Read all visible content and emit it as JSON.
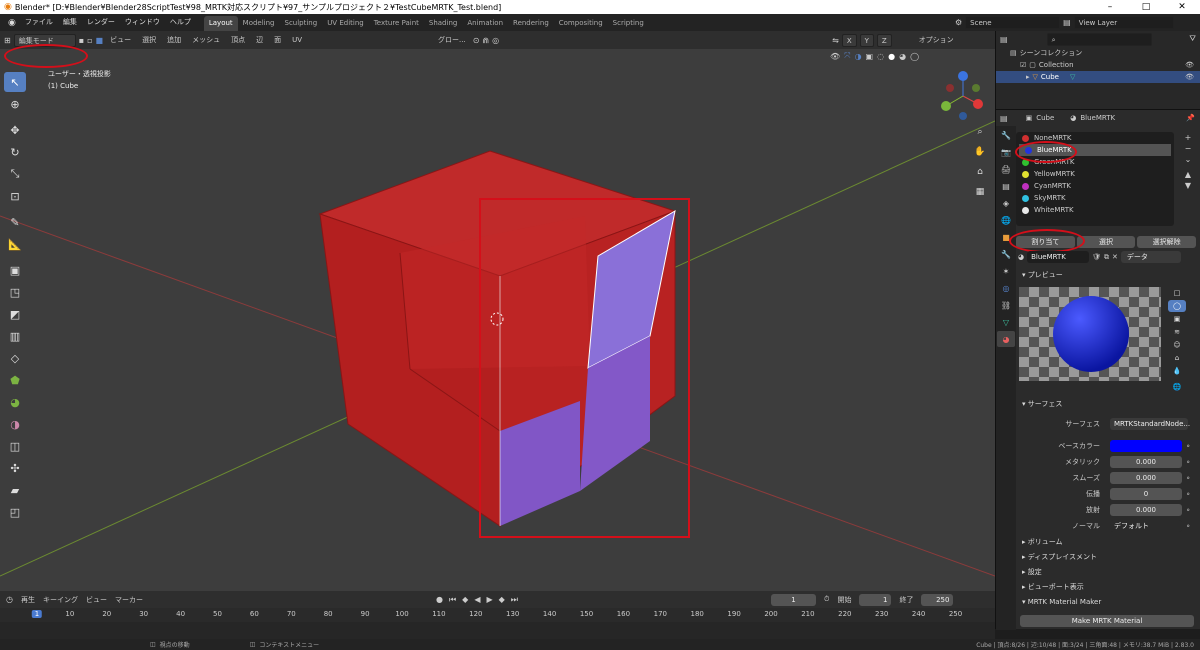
{
  "window": {
    "title": "Blender* [D:¥Blender¥Blender28ScriptTest¥98_MRTK対応スクリプト¥97_サンプルプロジェクト２¥TestCubeMRTK_Test.blend]",
    "controls": [
      "–",
      "□",
      "✕"
    ]
  },
  "menu": [
    "ファイル",
    "編集",
    "レンダー",
    "ウィンドウ",
    "ヘルプ"
  ],
  "workspaces": [
    "Layout",
    "Modeling",
    "Sculpting",
    "UV Editing",
    "Texture Paint",
    "Shading",
    "Animation",
    "Rendering",
    "Compositing",
    "Scripting"
  ],
  "active_workspace": "Layout",
  "scene": "Scene",
  "view_layer": "View Layer",
  "viewport": {
    "mode": "編集モード",
    "menus": [
      "ビュー",
      "選択",
      "追加",
      "メッシュ",
      "頂点",
      "辺",
      "面",
      "UV"
    ],
    "transform": "グロー...",
    "axes": [
      "X",
      "Y",
      "Z"
    ],
    "options": "オプション",
    "overlay_view": "ユーザー・透視投影",
    "overlay_object": "(1) Cube",
    "gizmo_labels": [
      "X",
      "Y",
      "Z"
    ]
  },
  "outliner": {
    "root": "シーンコレクション",
    "collection": "Collection",
    "object": "Cube"
  },
  "properties": {
    "breadcrumb_object": "Cube",
    "breadcrumb_material": "BlueMRTK",
    "slots": [
      "NoneMRTK",
      "BlueMRTK",
      "GreenMRTK",
      "YellowMRTK",
      "CyanMRTK",
      "SkyMRTK",
      "WhiteMRTK"
    ],
    "slot_colors": [
      "#d03030",
      "#2233dd",
      "#30c030",
      "#e0e030",
      "#c030c0",
      "#30c0e0",
      "#e8e8e8"
    ],
    "selected_slot": "BlueMRTK",
    "buttons": {
      "assign": "割り当て",
      "select": "選択",
      "deselect": "選択解除"
    },
    "material_name": "BlueMRTK",
    "data_dropdown": "データ",
    "preview_header": "プレビュー",
    "surface_header": "サーフェス",
    "surface_label": "サーフェス",
    "surface_value": "MRTKStandardNode...",
    "base_color_label": "ベースカラー",
    "base_color": "#0000ff",
    "metallic_label": "メタリック",
    "metallic": "0.000",
    "smooth_label": "スムーズ",
    "smooth": "0.000",
    "transmission_label": "伝播",
    "transmission": "0",
    "emission_label": "放射",
    "emission": "0.000",
    "normal_label": "ノーマル",
    "normal": "デフォルト",
    "panels": [
      "ボリューム",
      "ディスプレイスメント",
      "設定",
      "ビューポート表示",
      "MRTK Material Maker"
    ],
    "make_button": "Make MRTK Material"
  },
  "timeline": {
    "menus": [
      "再生",
      "キーイング",
      "ビュー",
      "マーカー"
    ],
    "current_frame": "1",
    "start_label": "開始",
    "start": "1",
    "end_label": "終了",
    "end": "250",
    "ticks": [
      "1",
      "10",
      "20",
      "30",
      "40",
      "50",
      "60",
      "70",
      "80",
      "90",
      "100",
      "110",
      "120",
      "130",
      "140",
      "150",
      "160",
      "170",
      "180",
      "190",
      "200",
      "210",
      "220",
      "230",
      "240",
      "250"
    ]
  },
  "status": {
    "left": "視点の移動",
    "middle": "コンテキストメニュー",
    "right": "Cube | 頂点:8/26 | 辺:10/48 | 面:3/24 | 三角面:48 | メモリ:38.7 MiB | 2.83.0"
  }
}
